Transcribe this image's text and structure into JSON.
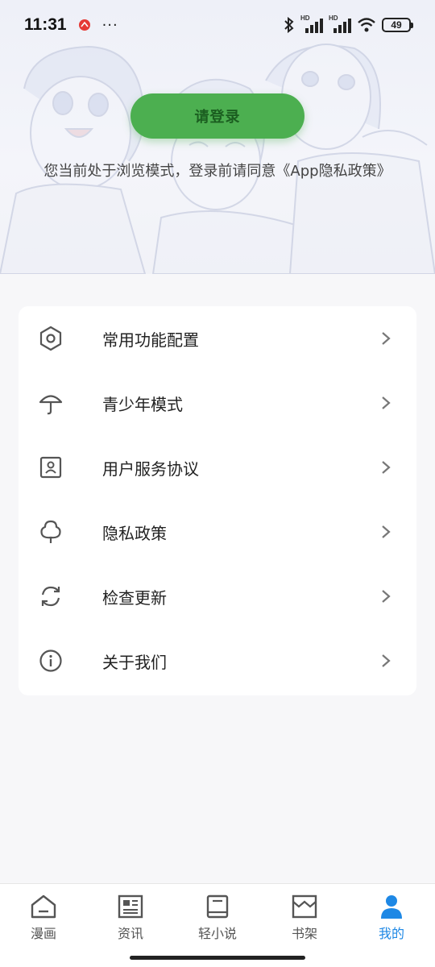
{
  "status_bar": {
    "time": "11:31",
    "dots": "···",
    "network_label_1": "HD",
    "network_label_2": "HD",
    "battery": "49"
  },
  "header": {
    "login_button": "请登录",
    "notice": "您当前处于浏览模式，登录前请同意《App隐私政策》"
  },
  "menu": {
    "items": [
      {
        "label": "常用功能配置",
        "icon": "hexagon-settings-icon"
      },
      {
        "label": "青少年模式",
        "icon": "umbrella-icon"
      },
      {
        "label": "用户服务协议",
        "icon": "id-card-icon"
      },
      {
        "label": "隐私政策",
        "icon": "tree-icon"
      },
      {
        "label": "检查更新",
        "icon": "refresh-icon"
      },
      {
        "label": "关于我们",
        "icon": "info-icon"
      }
    ]
  },
  "bottom_nav": {
    "items": [
      {
        "label": "漫画",
        "icon": "home-icon"
      },
      {
        "label": "资讯",
        "icon": "news-icon"
      },
      {
        "label": "轻小说",
        "icon": "book-icon"
      },
      {
        "label": "书架",
        "icon": "bookshelf-icon"
      },
      {
        "label": "我的",
        "icon": "person-icon",
        "active": true
      }
    ]
  },
  "colors": {
    "accent_green": "#4caf50",
    "active_blue": "#1e88e5"
  }
}
